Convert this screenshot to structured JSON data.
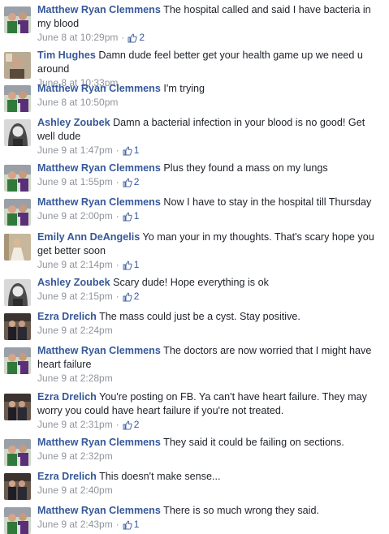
{
  "colors": {
    "author_link": "#365899",
    "body_text": "#1d2129",
    "meta_text": "#90949c"
  },
  "comments": [
    {
      "author": "Matthew Ryan Clemmens",
      "text": "The hospital called and said I have bacteria in my blood",
      "time": "June 8 at 10:29pm",
      "likes": "2",
      "avatar": "matthew-avatar"
    },
    {
      "author": "Tim Hughes",
      "text": "Damn dude feel better get your health game up we need u around",
      "time": "June 8 at 10:33pm",
      "likes": "",
      "avatar": "tim-avatar"
    },
    {
      "author": "Matthew Ryan Clemmens",
      "text": "I'm trying",
      "time": "June 8 at 10:50pm",
      "likes": "",
      "avatar": "matthew-avatar"
    },
    {
      "author": "Ashley Zoubek",
      "text": "Damn a bacterial infection in your blood is no good! Get well dude",
      "time": "June 9 at 1:47pm",
      "likes": "1",
      "avatar": "ashley-avatar"
    },
    {
      "author": "Matthew Ryan Clemmens",
      "text": "Plus they found a mass on my lungs",
      "time": "June 9 at 1:55pm",
      "likes": "2",
      "avatar": "matthew-avatar"
    },
    {
      "author": "Matthew Ryan Clemmens",
      "text": "Now I have to stay in the hospital till Thursday",
      "time": "June 9 at 2:00pm",
      "likes": "1",
      "avatar": "matthew-avatar"
    },
    {
      "author": "Emily Ann DeAngelis",
      "text": "Yo man your in my thoughts. That's scary hope you get better soon",
      "time": "June 9 at 2:14pm",
      "likes": "1",
      "avatar": "emily-avatar"
    },
    {
      "author": "Ashley Zoubek",
      "text": "Scary dude! Hope everything is ok",
      "time": "June 9 at 2:15pm",
      "likes": "2",
      "avatar": "ashley-avatar"
    },
    {
      "author": "Ezra Drelich",
      "text": "The mass could just be a cyst. Stay positive.",
      "time": "June 9 at 2:24pm",
      "likes": "",
      "avatar": "ezra-avatar"
    },
    {
      "author": "Matthew Ryan Clemmens",
      "text": "The doctors are now worried that I might have heart failure",
      "time": "June 9 at 2:28pm",
      "likes": "",
      "avatar": "matthew-avatar"
    },
    {
      "author": "Ezra Drelich",
      "text": "You're posting on FB. Ya can't have heart failure. They may worry you could have heart failure if you're not treated.",
      "time": "June 9 at 2:31pm",
      "likes": "2",
      "avatar": "ezra-avatar"
    },
    {
      "author": "Matthew Ryan Clemmens",
      "text": "They said it could be failing on sections.",
      "time": "June 9 at 2:32pm",
      "likes": "",
      "avatar": "matthew-avatar"
    },
    {
      "author": "Ezra Drelich",
      "text": "This doesn't make sense...",
      "time": "June 9 at 2:40pm",
      "likes": "",
      "avatar": "ezra-avatar"
    },
    {
      "author": "Matthew Ryan Clemmens",
      "text": "There is so much wrong they said.",
      "time": "June 9 at 2:43pm",
      "likes": "1",
      "avatar": "matthew-avatar"
    }
  ]
}
